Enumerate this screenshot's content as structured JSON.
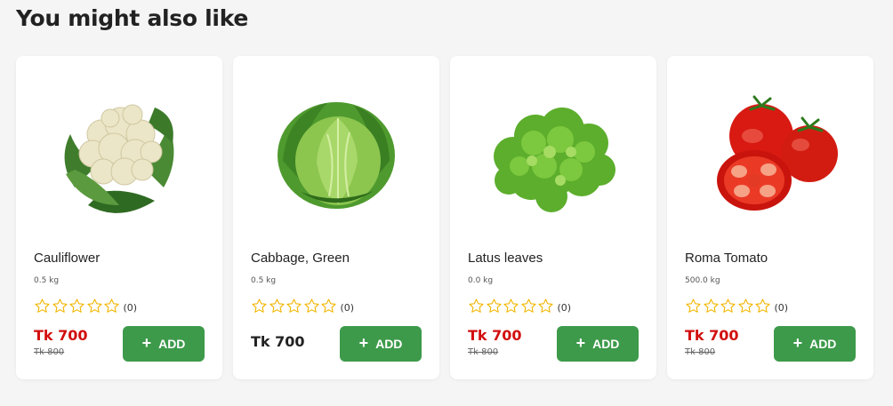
{
  "section": {
    "title": "You might also like"
  },
  "colors": {
    "accent": "#3d9a4a",
    "sale_price": "#d20e0e",
    "star": "#f2b600"
  },
  "products": [
    {
      "name": "Cauliflower",
      "weight": "0.5 kg",
      "rating": 0,
      "rating_count": "(0)",
      "price": "Tk 700",
      "old_price": "Tk 800",
      "on_sale": true,
      "add_label": "ADD",
      "image": "cauliflower"
    },
    {
      "name": "Cabbage, Green",
      "weight": "0.5 kg",
      "rating": 0,
      "rating_count": "(0)",
      "price": "Tk 700",
      "old_price": null,
      "on_sale": false,
      "add_label": "ADD",
      "image": "cabbage"
    },
    {
      "name": "Latus leaves",
      "weight": "0.0 kg",
      "rating": 0,
      "rating_count": "(0)",
      "price": "Tk 700",
      "old_price": "Tk 800",
      "on_sale": true,
      "add_label": "ADD",
      "image": "lettuce"
    },
    {
      "name": "Roma Tomato",
      "weight": "500.0 kg",
      "rating": 0,
      "rating_count": "(0)",
      "price": "Tk 700",
      "old_price": "Tk 800",
      "on_sale": true,
      "add_label": "ADD",
      "image": "tomato"
    }
  ],
  "icons": {
    "star": "star-outline-icon",
    "add": "plus-icon"
  }
}
